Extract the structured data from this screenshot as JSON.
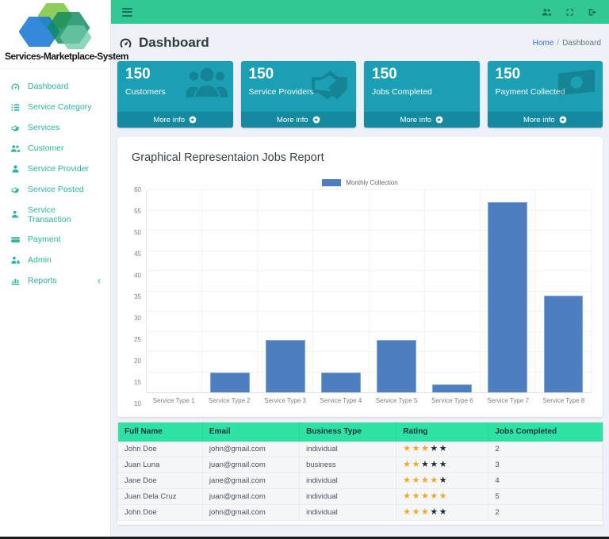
{
  "brand": {
    "title": "Services-Marketplace-System"
  },
  "navbar": {
    "icons": [
      {
        "name": "users-icon"
      },
      {
        "name": "fullscreen-icon"
      },
      {
        "name": "signout-icon"
      }
    ]
  },
  "sidebar": {
    "items": [
      {
        "label": "Dashboard",
        "icon": "gauge-icon"
      },
      {
        "label": "Service Category",
        "icon": "list-icon"
      },
      {
        "label": "Services",
        "icon": "handshake-icon"
      },
      {
        "label": "Customer",
        "icon": "users-icon"
      },
      {
        "label": "Service Provider",
        "icon": "user-icon"
      },
      {
        "label": "Service Posted",
        "icon": "handshake-icon"
      },
      {
        "label": "Service Transaction",
        "icon": "user-icon"
      },
      {
        "label": "Payment",
        "icon": "credit-card-icon"
      },
      {
        "label": "Admin",
        "icon": "user-lock-icon"
      },
      {
        "label": "Reports",
        "icon": "chart-bar-icon",
        "chevron": "‹"
      }
    ]
  },
  "header": {
    "title": "Dashboard",
    "breadcrumb": {
      "home": "Home",
      "separator": "/",
      "current": "Dashboard"
    }
  },
  "stats": [
    {
      "value": "150",
      "label": "Customers",
      "more_info": "More info",
      "icon": "users-icon"
    },
    {
      "value": "150",
      "label": "Service Providers",
      "more_info": "More info",
      "icon": "handshake-icon"
    },
    {
      "value": "150",
      "label": "Jobs Completed",
      "more_info": "More info",
      "icon": ""
    },
    {
      "value": "150",
      "label": "Payment Collected",
      "more_info": "More info",
      "icon": "money-bill-icon"
    }
  ],
  "chart_card": {
    "title": "Graphical Representaion Jobs Report"
  },
  "chart_data": {
    "type": "bar",
    "title": "Graphical Representaion Jobs Report",
    "legend": [
      {
        "label": "Monthly Collection",
        "color": "#4d7fc0"
      }
    ],
    "legend_position": "top-center",
    "categories": [
      "Service Type 1",
      "Service Type 2",
      "Service Type 3",
      "Service Type 4",
      "Service Type 5",
      "Service Type 6",
      "Service Type 7",
      "Service Type 8"
    ],
    "values": [
      10,
      15,
      23,
      15,
      23,
      12,
      57,
      34
    ],
    "xlabel": "",
    "ylabel": "",
    "ylim": [
      10,
      60
    ],
    "ytick_step": 5,
    "grid": true
  },
  "table": {
    "columns": [
      "Full Name",
      "Email",
      "Business Type",
      "Rating",
      "Jobs Completed"
    ],
    "max_stars": 5,
    "rows": [
      {
        "full_name": "John Doe",
        "email": "john@gmail.com",
        "business_type": "individual",
        "rating": 3,
        "jobs_completed": "2"
      },
      {
        "full_name": "Juan Luna",
        "email": "juan@gmail.com",
        "business_type": "business",
        "rating": 2,
        "jobs_completed": "3"
      },
      {
        "full_name": "Jane Doe",
        "email": "jane@gmail.com",
        "business_type": "individual",
        "rating": 4,
        "jobs_completed": "4"
      },
      {
        "full_name": "Juan Dela Cruz",
        "email": "juan@gmail.com",
        "business_type": "individual",
        "rating": 5,
        "jobs_completed": "5"
      },
      {
        "full_name": "John Doe",
        "email": "john@gmail.com",
        "business_type": "individual",
        "rating": 3,
        "jobs_completed": "2"
      }
    ]
  },
  "colors": {
    "navbar": "#32c893",
    "table_header": "#2ce3a4",
    "info_box": "#1a9fb4",
    "info_box_footer": "#15899f",
    "sidebar_link": "#2ab3a3",
    "bar": "#4d7fc0",
    "bar_border": "#7babde",
    "star_filled": "#f5a623",
    "star_empty": "#1e2936",
    "breadcrumb_link": "#3b6ff5"
  }
}
